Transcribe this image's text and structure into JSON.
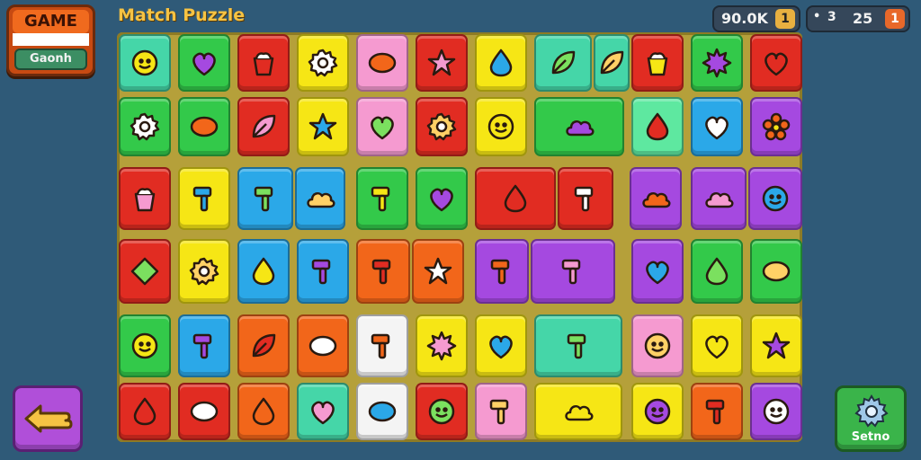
{
  "logo": {
    "top_text": "GAME",
    "bottom_text": "Gaonh"
  },
  "title": "Match Puzzle",
  "hud": {
    "score": "90.0K",
    "score_badge": "1",
    "moves_prefix": "•",
    "moves_a": "3",
    "moves_b": "25",
    "moves_badge": "1"
  },
  "settings_label": "Setno",
  "colors": {
    "green": "#33c94a",
    "lime": "#7be05f",
    "red": "#e12c22",
    "orange": "#f2661a",
    "yellow": "#f6e615",
    "pink": "#f59ad0",
    "purple": "#a549e0",
    "blue": "#2ba8e8",
    "teal": "#45d6a8",
    "mint": "#5ee8a0",
    "white": "#f4f4f4"
  },
  "icons": [
    "sun-face-icon",
    "heart-icon",
    "arch-icon",
    "gear-icon",
    "number-9-icon",
    "star-icon",
    "drop-face-icon",
    "leaf-icon",
    "leaf-icon",
    "bowl-icon",
    "sun-icon",
    "heart-icon",
    "gear-icon",
    "bean-icon",
    "leaf-icon",
    "star-icon",
    "heart-icon",
    "gear-icon",
    "face-icon",
    "fish-icon",
    "potato-icon",
    "heart-icon",
    "flower-icon",
    "cup-icon",
    "hammer-icon",
    "key-icon",
    "cloud-icon",
    "boot-icon",
    "heart-icon",
    "bird-icon",
    "tube-icon",
    "wing-icon",
    "cloud-icon",
    "cookie-icon",
    "diamond-icon",
    "gear-icon",
    "acorn-icon",
    "flag-icon",
    "hammer-icon",
    "star-icon",
    "cross-icon",
    "bottle-icon",
    "heart-icon",
    "carrot-icon",
    "ball-icon",
    "face-icon",
    "calculator-icon",
    "leaf-icon",
    "palette-icon",
    "rocket-icon",
    "sun-icon",
    "heart-icon",
    "brush-icon",
    "face-icon",
    "fire-icon",
    "star-icon",
    "acorn-icon",
    "blob-icon",
    "snail-icon",
    "heart-icon",
    "bug-icon",
    "face-icon",
    "scissors-icon",
    "wave-icon",
    "cookie-icon",
    "battery-icon",
    "face-icon"
  ]
}
